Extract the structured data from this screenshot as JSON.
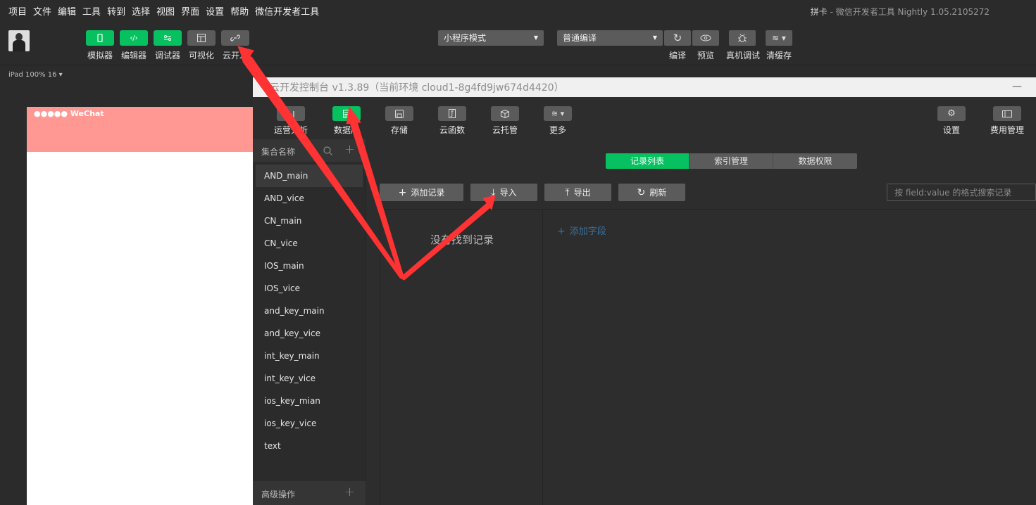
{
  "menu": [
    "项目",
    "文件",
    "编辑",
    "工具",
    "转到",
    "选择",
    "视图",
    "界面",
    "设置",
    "帮助",
    "微信开发者工具"
  ],
  "app_title": {
    "project": "拼卡",
    "suffix": " - 微信开发者工具 Nightly 1.05.2105272"
  },
  "toolbar": {
    "left_buttons": [
      {
        "label": "模拟器",
        "icon": "phone-icon"
      },
      {
        "label": "编辑器",
        "icon": "code-icon"
      },
      {
        "label": "调试器",
        "icon": "debug-toggle-icon"
      },
      {
        "label": "可视化",
        "icon": "layout-icon"
      },
      {
        "label": "云开发",
        "icon": "cloud-link-icon"
      }
    ],
    "mode_select": "小程序模式",
    "compile_select": "普通编译",
    "right_buttons": [
      {
        "label": "编译",
        "icon": "refresh-icon"
      },
      {
        "label": "预览",
        "icon": "eye-icon"
      },
      {
        "label": "真机调试",
        "icon": "bug-icon"
      },
      {
        "label": "清缓存",
        "icon": "layers-icon"
      }
    ]
  },
  "simulator": {
    "device": "iPad 100% 16 ▾",
    "status": "●●●●● WeChat"
  },
  "console": {
    "title": "云开发控制台 v1.3.89（当前环境 cloud1-8g4fd9jw674d4420）",
    "minimize": "—",
    "nav_left": [
      {
        "label": "运营分析",
        "icon": "chart-icon"
      },
      {
        "label": "数据库",
        "icon": "database-icon"
      },
      {
        "label": "存储",
        "icon": "storage-icon"
      },
      {
        "label": "云函数",
        "icon": "function-icon"
      },
      {
        "label": "云托管",
        "icon": "cube-icon"
      },
      {
        "label": "更多",
        "icon": "layers-icon"
      }
    ],
    "nav_right": [
      {
        "label": "设置",
        "icon": "gear-icon"
      },
      {
        "label": "费用管理",
        "icon": "billing-icon"
      }
    ],
    "collections_header": "集合名称",
    "collections": [
      "AND_main",
      "AND_vice",
      "CN_main",
      "CN_vice",
      "IOS_main",
      "IOS_vice",
      "and_key_main",
      "and_key_vice",
      "int_key_main",
      "int_key_vice",
      "ios_key_mian",
      "ios_key_vice",
      "text"
    ],
    "advanced": "高级操作",
    "tabs": [
      "记录列表",
      "索引管理",
      "数据权限"
    ],
    "actions": [
      {
        "label": "添加记录",
        "icon": "+"
      },
      {
        "label": "导入",
        "icon": "⤓"
      },
      {
        "label": "导出",
        "icon": "⤒"
      },
      {
        "label": "刷新",
        "icon": "↻"
      }
    ],
    "search_placeholder": "按 field:value 的格式搜索记录",
    "empty_text": "没有找到记录",
    "add_field": "添加字段"
  }
}
